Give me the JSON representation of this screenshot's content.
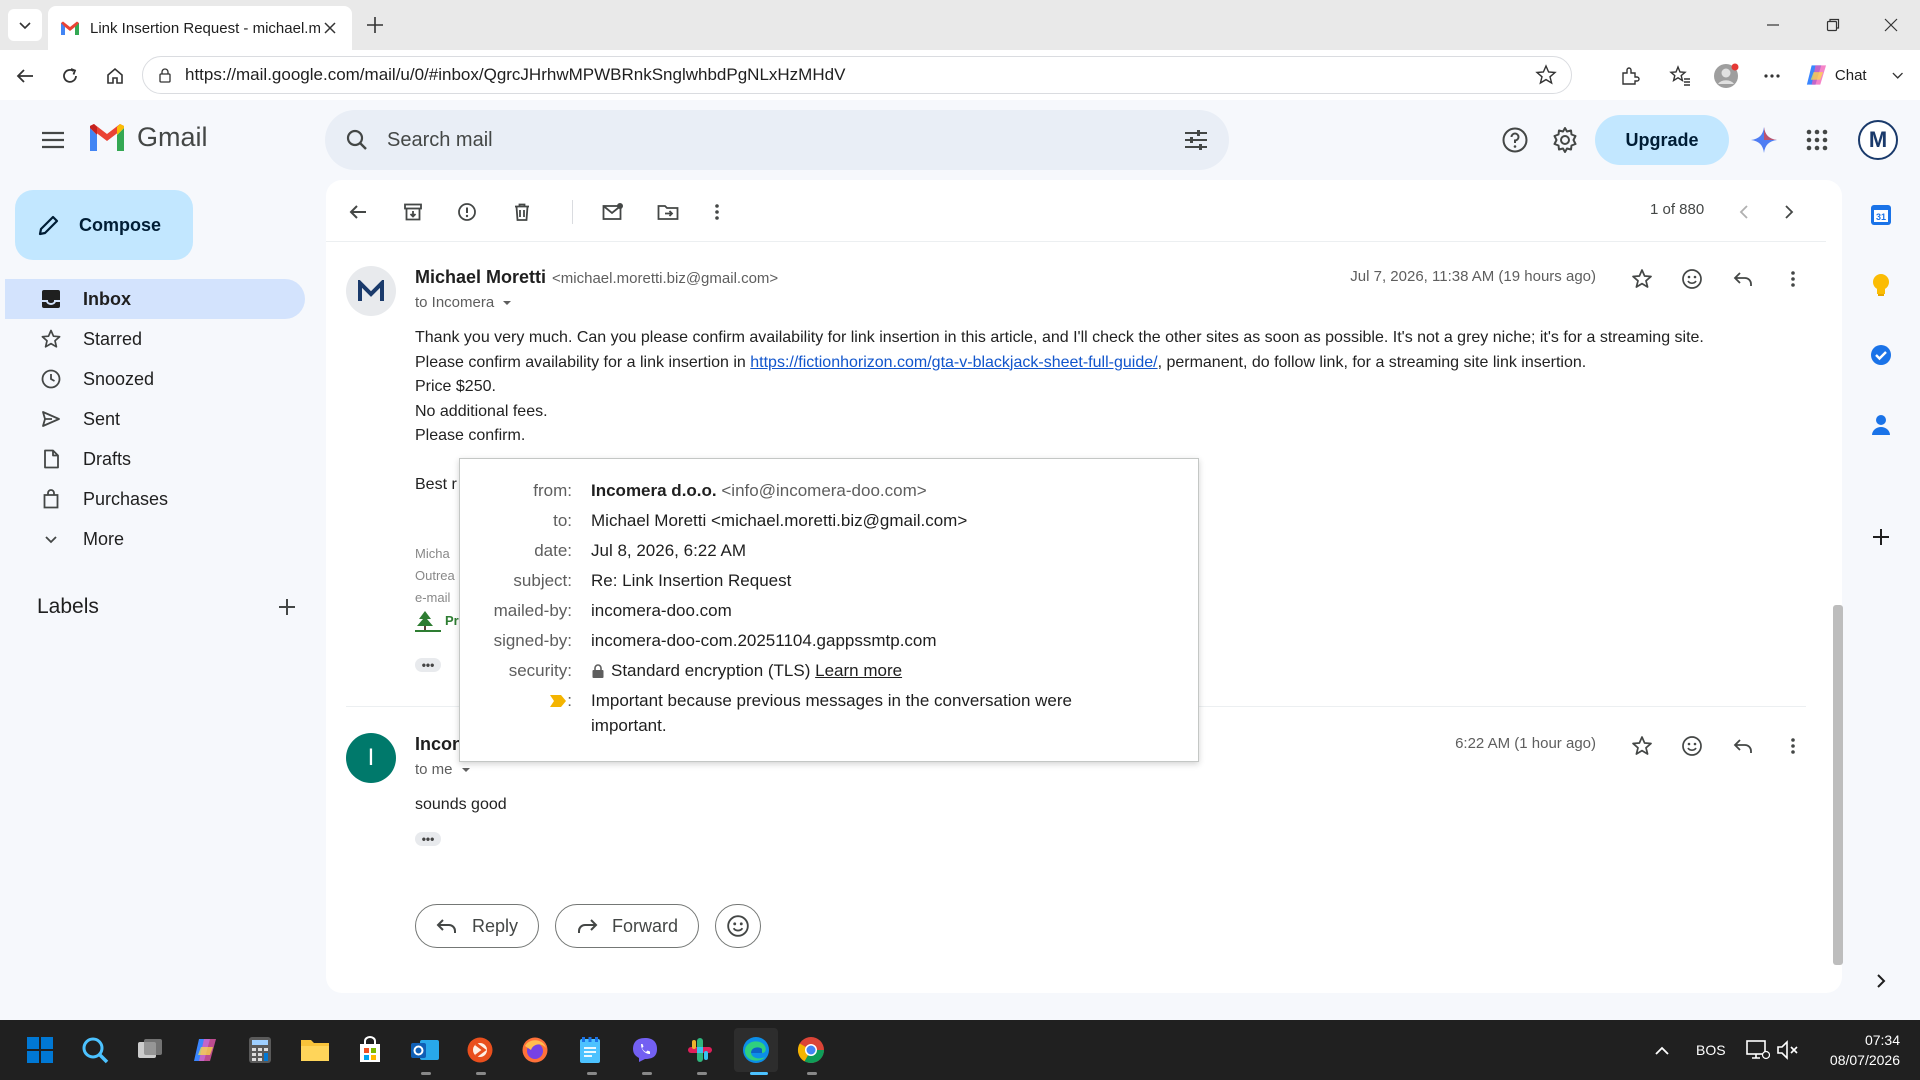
{
  "browser": {
    "tab_title": "Link Insertion Request - michael.m",
    "url": "https://mail.google.com/mail/u/0/#inbox/QgrcJHrhwMPWBRnkSnglwhbdPgNLxHzMHdV",
    "chat_label": "Chat"
  },
  "gmail": {
    "logo_text": "Gmail",
    "search_placeholder": "Search mail",
    "upgrade_label": "Upgrade",
    "avatar_letter": "M"
  },
  "sidebar": {
    "compose_label": "Compose",
    "items": [
      {
        "label": "Inbox",
        "icon": "inbox-icon",
        "active": true
      },
      {
        "label": "Starred",
        "icon": "star-icon"
      },
      {
        "label": "Snoozed",
        "icon": "clock-icon"
      },
      {
        "label": "Sent",
        "icon": "send-icon"
      },
      {
        "label": "Drafts",
        "icon": "draft-icon"
      },
      {
        "label": "Purchases",
        "icon": "shopping-bag-icon"
      },
      {
        "label": "More",
        "icon": "chevron-down-icon"
      }
    ],
    "labels_title": "Labels"
  },
  "toolbar": {
    "pager": "1 of 880"
  },
  "message1": {
    "avatar": "M",
    "sender_name": "Michael Moretti",
    "sender_email": "<michael.moretti.biz@gmail.com>",
    "to": "to Incomera",
    "date": "Jul 7, 2026, 11:38 AM (19 hours ago)",
    "line1": "Thank you very much. Can you please confirm availability for link insertion in this article, and I'll check the other sites as soon as possible. It's not a grey niche; it's for a streaming site.",
    "line2_pre": "Please confirm availability for a link insertion in ",
    "line2_link": "https://fictionhorizon.com/gta-v-blackjack-sheet-full-guide/",
    "line2_post": ", permanent, do follow link, for a streaming site link insertion.",
    "line3": "Price  $250.",
    "line4": "No additional fees.",
    "line5": "Please confirm.",
    "closing_partial": "Best r",
    "sig_name_partial": "Micha",
    "sig_role_partial": "Outrea",
    "sig_email_partial": "e-mail",
    "sig_logo_partial": "Pr"
  },
  "popup": {
    "from_key": "from:",
    "from_name": "Incomera d.o.o.",
    "from_email": "<info@incomera-doo.com>",
    "to_key": "to:",
    "to_val": "Michael Moretti <michael.moretti.biz@gmail.com>",
    "date_key": "date:",
    "date_val": "Jul 8, 2026, 6:22 AM",
    "subject_key": "subject:",
    "subject_val": "Re: Link Insertion Request",
    "mailedby_key": "mailed-by:",
    "mailedby_val": "incomera-doo.com",
    "signedby_key": "signed-by:",
    "signedby_val": "incomera-doo-com.20251104.gappssmtp.com",
    "security_key": "security:",
    "security_val": "Standard encryption (TLS)",
    "learn_more": "Learn more",
    "important_key": ":",
    "important_val": "Important because previous messages in the conversation were important."
  },
  "message2": {
    "avatar": "I",
    "sender_partial": "Incon",
    "to": "to me",
    "date": "6:22 AM (1 hour ago)",
    "body": "sounds good"
  },
  "actions": {
    "reply_label": "Reply",
    "forward_label": "Forward"
  },
  "taskbar": {
    "language": "BOS",
    "time": "07:34",
    "date": "08/07/2026"
  },
  "colors": {
    "accent": "#c2e7ff",
    "active_nav": "#d3e3fd",
    "link": "#1155cc",
    "avatar_incomera": "#00796b"
  }
}
